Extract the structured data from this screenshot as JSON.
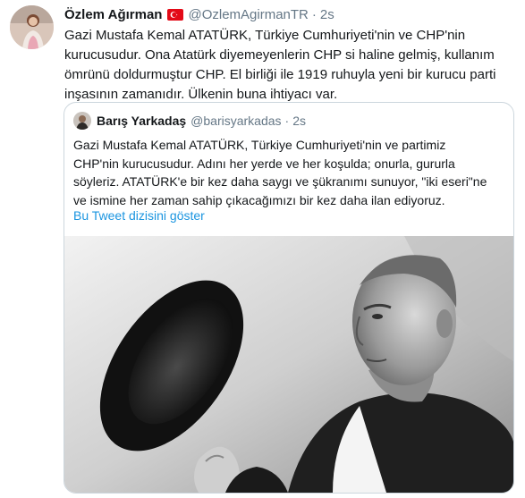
{
  "tweet": {
    "author_name": "Özlem Ağırman",
    "flag_icon": "turkey-flag-icon",
    "handle": "@OzlemAgirmanTR",
    "separator": "·",
    "timestamp": "2s",
    "text_lines": [
      "Gazi Mustafa Kemal ATATÜRK, Türkiye Cumhuriyeti'nin ve  CHP'nin",
      "kurucusudur. Ona Atatürk diyemeyenlerin CHP si haline gelmiş, kullanım",
      "ömrünü doldurmuştur CHP. El birliği ile 1919 ruhuyla yeni bir kurucu parti",
      "inşasının zamanıdır. Ülkenin buna ihtiyacı var."
    ]
  },
  "quoted": {
    "author_name": "Barış Yarkadaş",
    "handle": "@barisyarkadas",
    "separator": "·",
    "timestamp": "2s",
    "text_lines": [
      "Gazi Mustafa Kemal ATATÜRK, Türkiye Cumhuriyeti'nin ve partimiz",
      "CHP'nin kurucusudur. Adını her yerde ve her koşulda; onurla, gururla",
      "söyleriz. ATATÜRK'e bir kez daha saygı ve şükranımı sunuyor, \"iki eseri\"ne",
      "ve ismine her zaman sahip çıkacağımızı bir kez daha ilan ediyoruz."
    ],
    "show_thread_label": "Bu Tweet dizisini göster"
  },
  "colors": {
    "link": "#1b95e0",
    "secondary_text": "#657786",
    "border": "#ccd6dd",
    "flag_red": "#e30a17"
  }
}
